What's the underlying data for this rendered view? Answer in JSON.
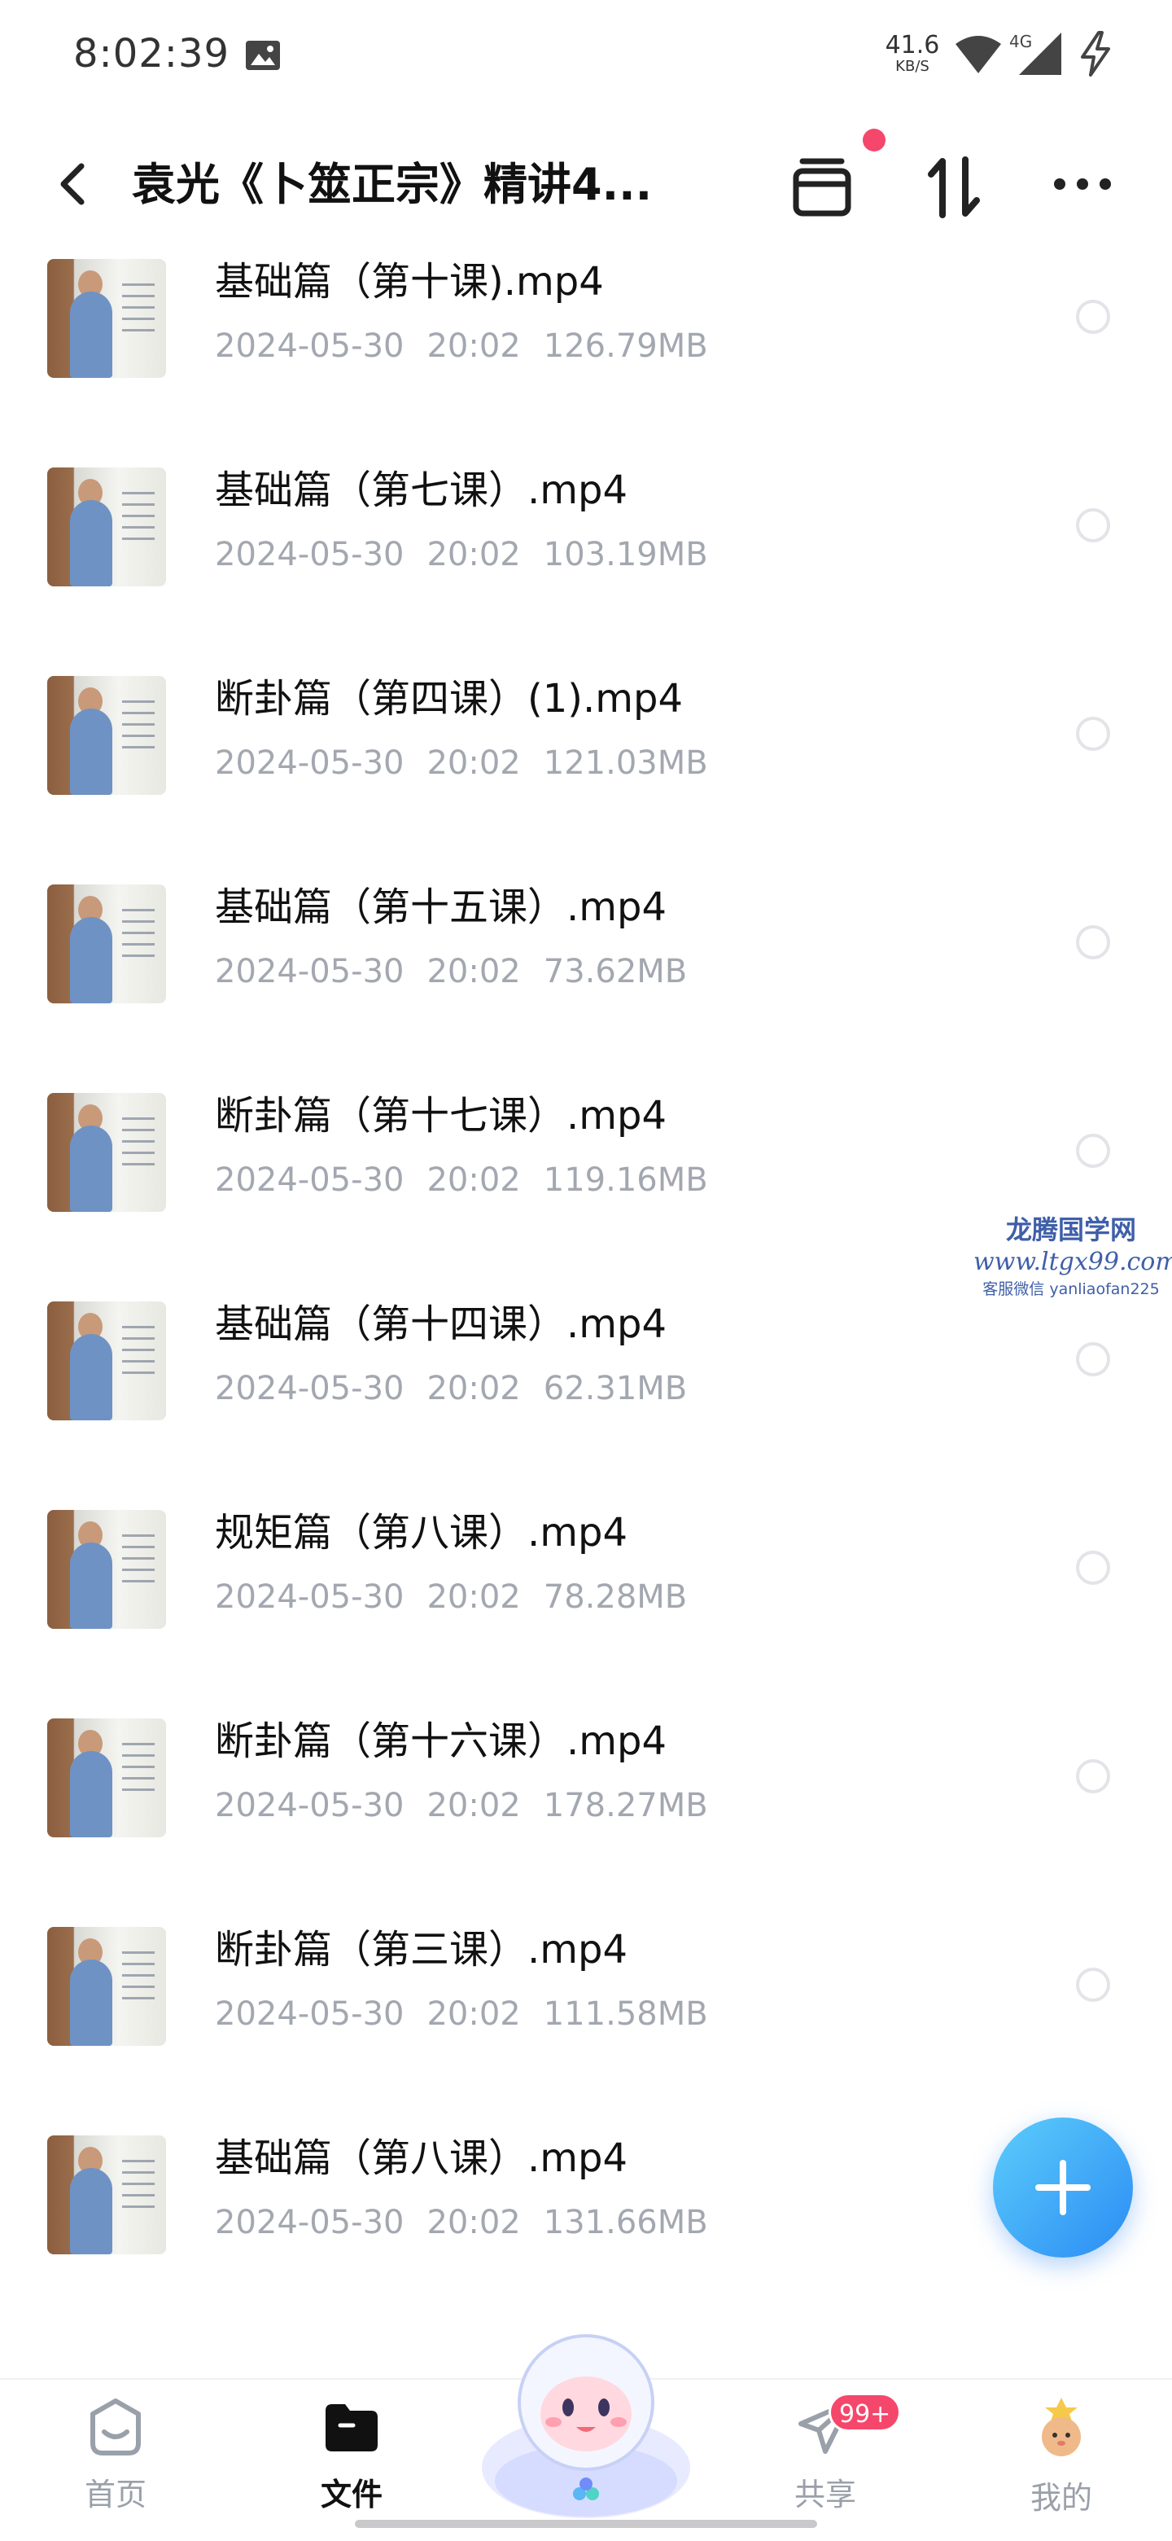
{
  "status_bar": {
    "time": "8:02:39",
    "net_speed_value": "41.6",
    "net_speed_unit": "KB/S",
    "network_type": "4G",
    "icons": [
      "image-icon",
      "wifi-icon",
      "cellular-signal-icon",
      "charging-bolt-icon"
    ]
  },
  "header": {
    "title": "袁光《卜筮正宗》精讲4...",
    "icons": [
      "back-icon",
      "archive-box-icon",
      "sort-icon",
      "more-icon"
    ],
    "notification_dot_color": "#f5476b"
  },
  "files": [
    {
      "name": "基础篇（第十课).mp4",
      "date": "2024-05-30",
      "time": "20:02",
      "size": "126.79MB"
    },
    {
      "name": "基础篇（第七课）.mp4",
      "date": "2024-05-30",
      "time": "20:02",
      "size": "103.19MB"
    },
    {
      "name": "断卦篇（第四课）(1).mp4",
      "date": "2024-05-30",
      "time": "20:02",
      "size": "121.03MB"
    },
    {
      "name": "基础篇（第十五课）.mp4",
      "date": "2024-05-30",
      "time": "20:02",
      "size": "73.62MB"
    },
    {
      "name": "断卦篇（第十七课）.mp4",
      "date": "2024-05-30",
      "time": "20:02",
      "size": "119.16MB"
    },
    {
      "name": "基础篇（第十四课）.mp4",
      "date": "2024-05-30",
      "time": "20:02",
      "size": "62.31MB"
    },
    {
      "name": "规矩篇（第八课）.mp4",
      "date": "2024-05-30",
      "time": "20:02",
      "size": "78.28MB"
    },
    {
      "name": "断卦篇（第十六课）.mp4",
      "date": "2024-05-30",
      "time": "20:02",
      "size": "178.27MB"
    },
    {
      "name": "断卦篇（第三课）.mp4",
      "date": "2024-05-30",
      "time": "20:02",
      "size": "111.58MB"
    },
    {
      "name": "基础篇（第八课）.mp4",
      "date": "2024-05-30",
      "time": "20:02",
      "size": "131.66MB"
    }
  ],
  "watermark": {
    "title": "龙腾国学网",
    "url": "www.ltgx99.com",
    "note": "客服微信 yanliaofan225"
  },
  "fab": {
    "icon": "plus-icon",
    "color_start": "#5ccdfb",
    "color_end": "#2b8cf4"
  },
  "bottom_nav": {
    "items": [
      {
        "label": "首页",
        "icon": "home-icon",
        "active": false
      },
      {
        "label": "文件",
        "icon": "folder-icon",
        "active": true
      },
      {
        "label": "共享",
        "icon": "paper-plane-icon",
        "active": false,
        "badge": "99+"
      },
      {
        "label": "我的",
        "icon": "avatar-icon",
        "active": false
      }
    ],
    "center_icon": "mascot-icon"
  }
}
